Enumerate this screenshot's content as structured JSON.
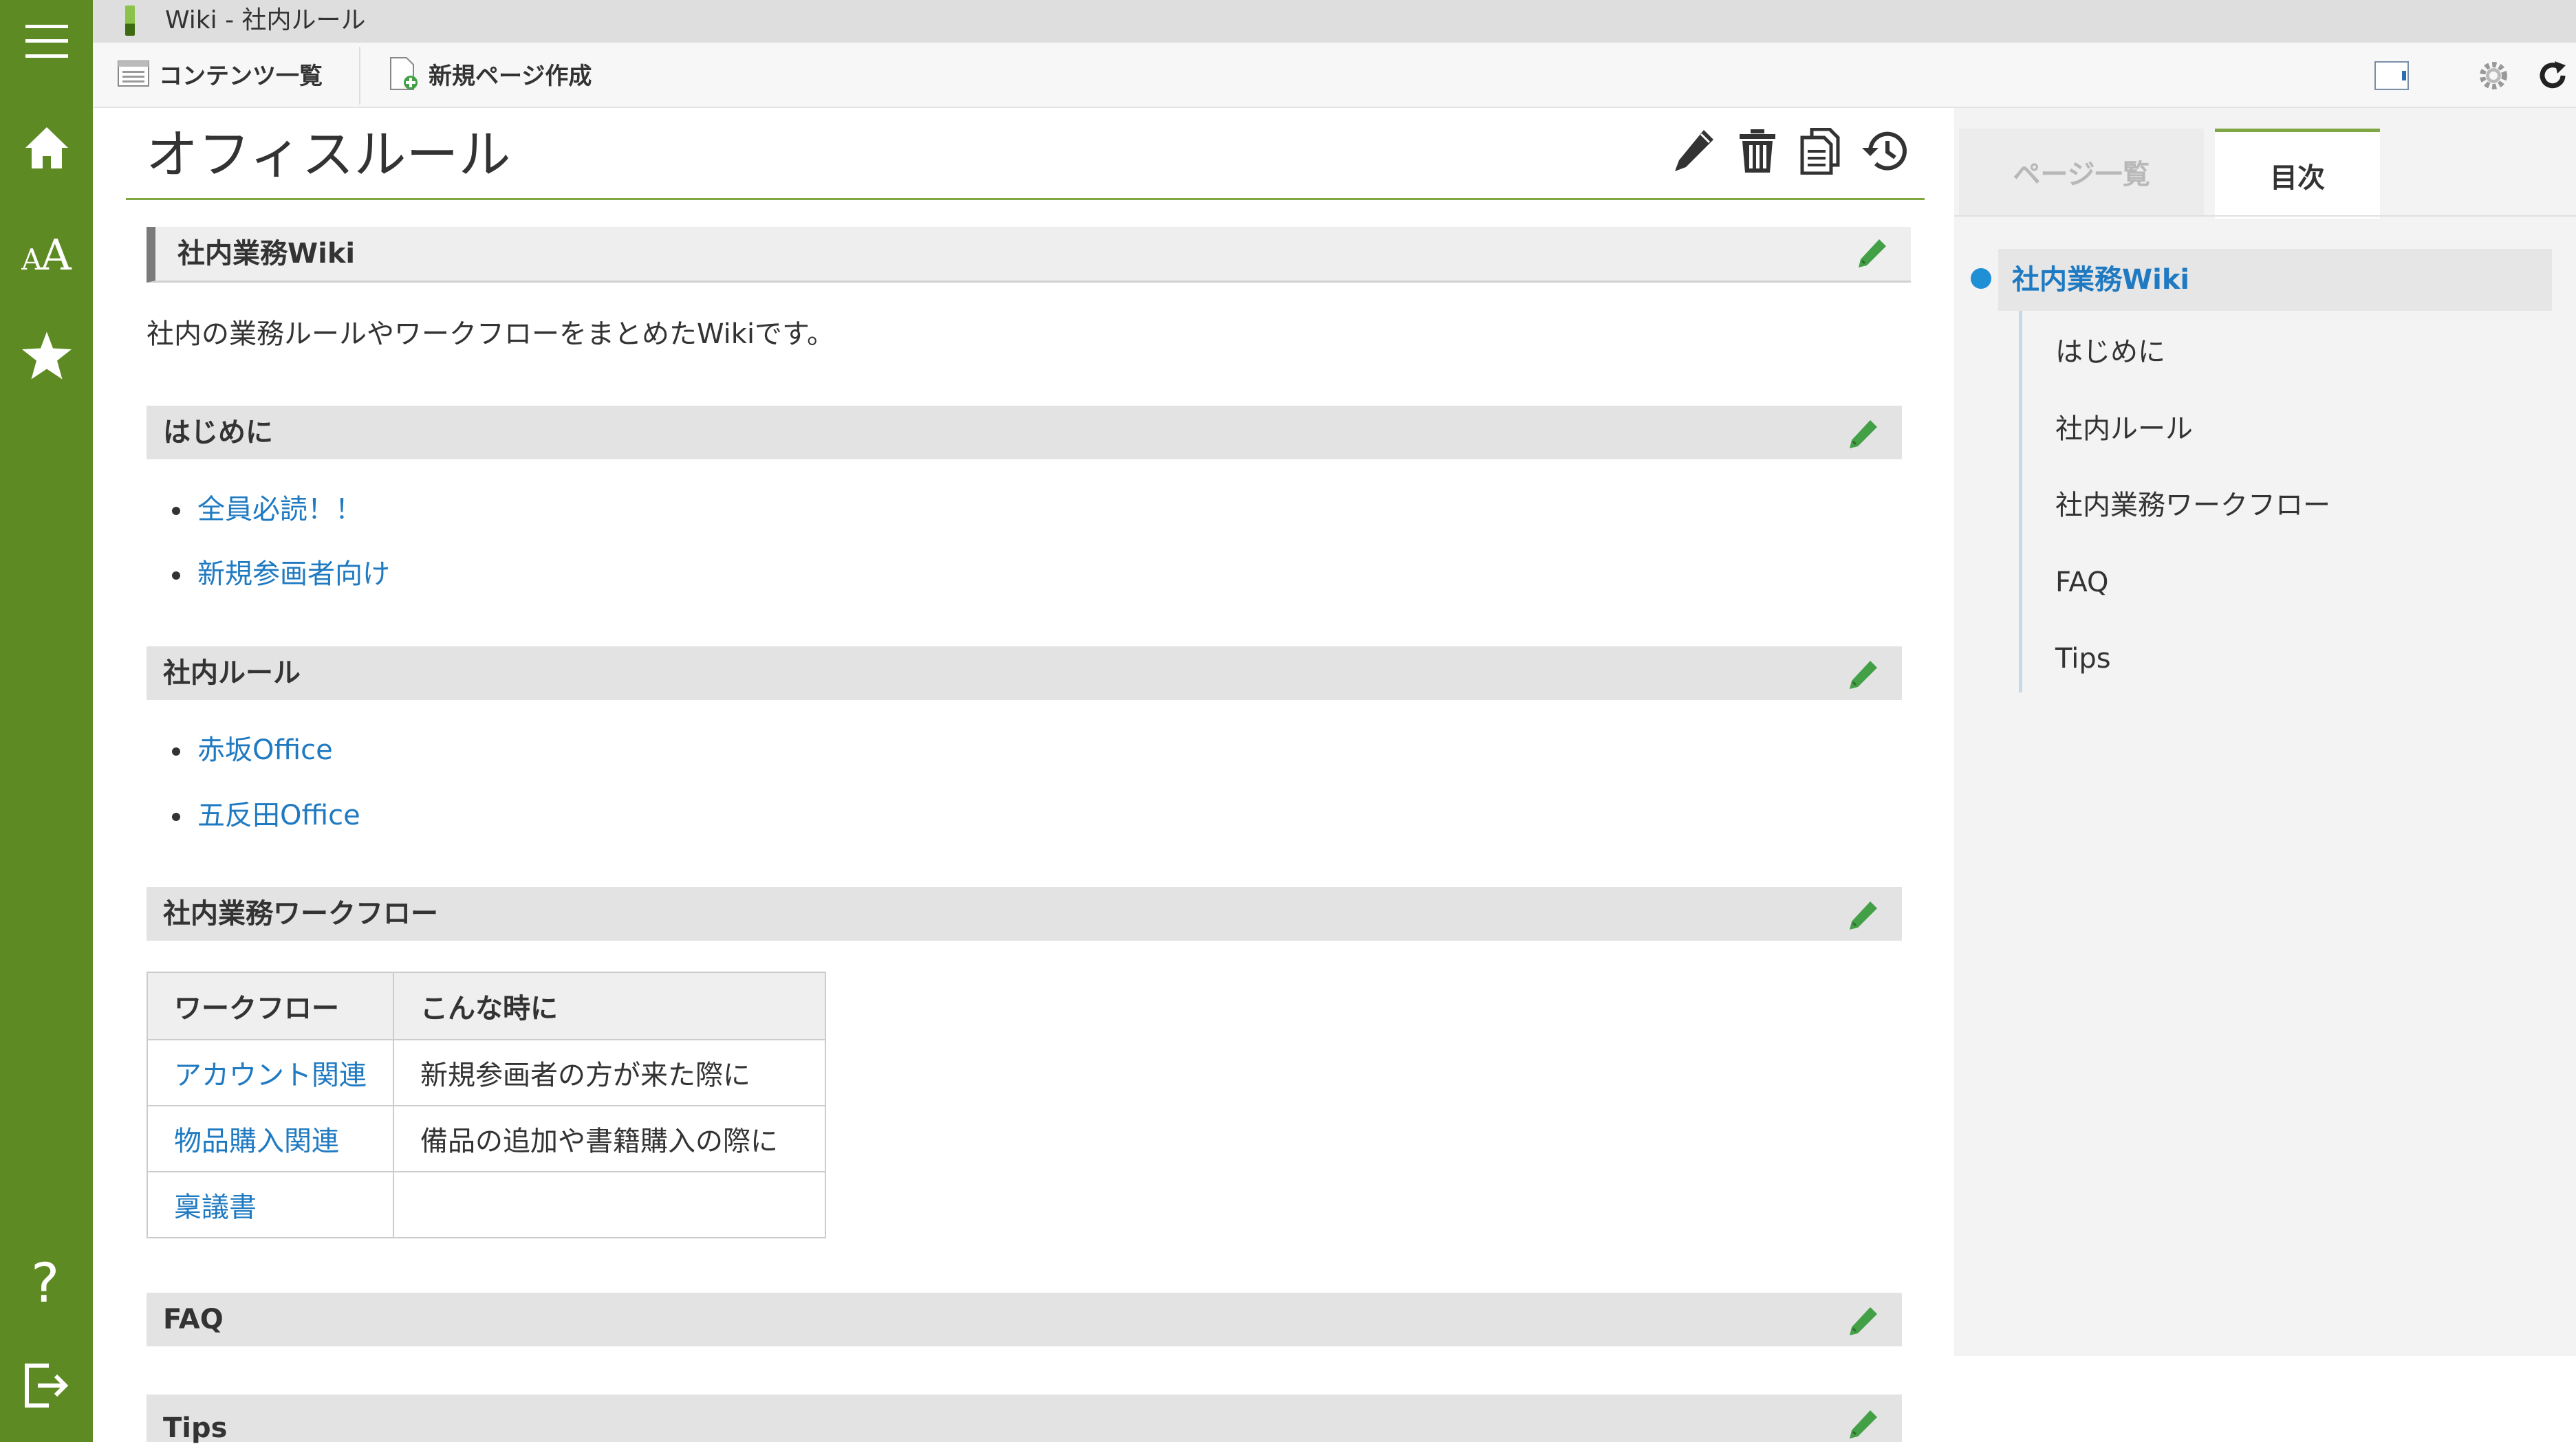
{
  "window": {
    "title": "Wiki - 社内ルール"
  },
  "toolbar": {
    "contents_list_label": "コンテンツ一覧",
    "new_page_label": "新規ページ作成"
  },
  "page": {
    "title": "オフィスルール"
  },
  "sections": {
    "wiki": {
      "heading": "社内業務Wiki",
      "text": "社内の業務ルールやワークフローをまとめたWikiです。"
    },
    "intro": {
      "heading": "はじめに",
      "links": [
        "全員必読！！",
        "新規参画者向け"
      ]
    },
    "rules": {
      "heading": "社内ルール",
      "links": [
        "赤坂Office",
        "五反田Office"
      ]
    },
    "workflow": {
      "heading": "社内業務ワークフロー",
      "table": {
        "headers": [
          "ワークフロー",
          "こんな時に"
        ],
        "rows": [
          [
            "アカウント関連",
            "新規参画者の方が来た際に"
          ],
          [
            "物品購入関連",
            "備品の追加や書籍購入の際に"
          ],
          [
            "稟議書",
            ""
          ]
        ]
      }
    },
    "faq": {
      "heading": "FAQ"
    },
    "tips": {
      "heading": "Tips"
    }
  },
  "right_panel": {
    "tabs": [
      "ページ一覧",
      "目次"
    ],
    "active_tab": "目次",
    "toc": {
      "current": "社内業務Wiki",
      "items": [
        "はじめに",
        "社内ルール",
        "社内業務ワークフロー",
        "FAQ",
        "Tips"
      ]
    }
  },
  "colors": {
    "sidebar": "#5e8a24",
    "accent": "#7fa744",
    "link": "#1f7ac2",
    "section_bg": "#e3e3e3",
    "edit_icon": "#43a047"
  },
  "icons": {
    "sidebar": [
      "menu-icon",
      "home-icon",
      "font-size-icon",
      "star-icon",
      "help-icon",
      "logout-icon"
    ],
    "page_actions": [
      "pencil-icon",
      "trash-icon",
      "copy-icon",
      "history-icon"
    ],
    "toolbar_right": [
      "panel-toggle-icon",
      "gear-icon",
      "refresh-icon"
    ]
  }
}
